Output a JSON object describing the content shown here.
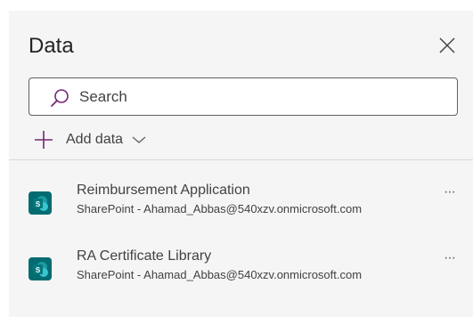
{
  "panel": {
    "title": "Data",
    "close_icon": "close-icon"
  },
  "search": {
    "placeholder": "Search",
    "value": "",
    "icon": "search-icon"
  },
  "add_data": {
    "label": "Add data",
    "icon": "plus-icon",
    "chevron": "chevron-down-icon"
  },
  "sources": [
    {
      "name": "Reimbursement Application",
      "subtitle": "SharePoint - Ahamad_Abbas@540xzv.onmicrosoft.com",
      "icon": "sharepoint-icon",
      "more": "···"
    },
    {
      "name": "RA Certificate Library",
      "subtitle": "SharePoint - Ahamad_Abbas@540xzv.onmicrosoft.com",
      "icon": "sharepoint-icon",
      "more": "···"
    }
  ],
  "colors": {
    "accent": "#742774",
    "sharepoint": "#036c70",
    "panel_bg": "#f5f5f5"
  }
}
